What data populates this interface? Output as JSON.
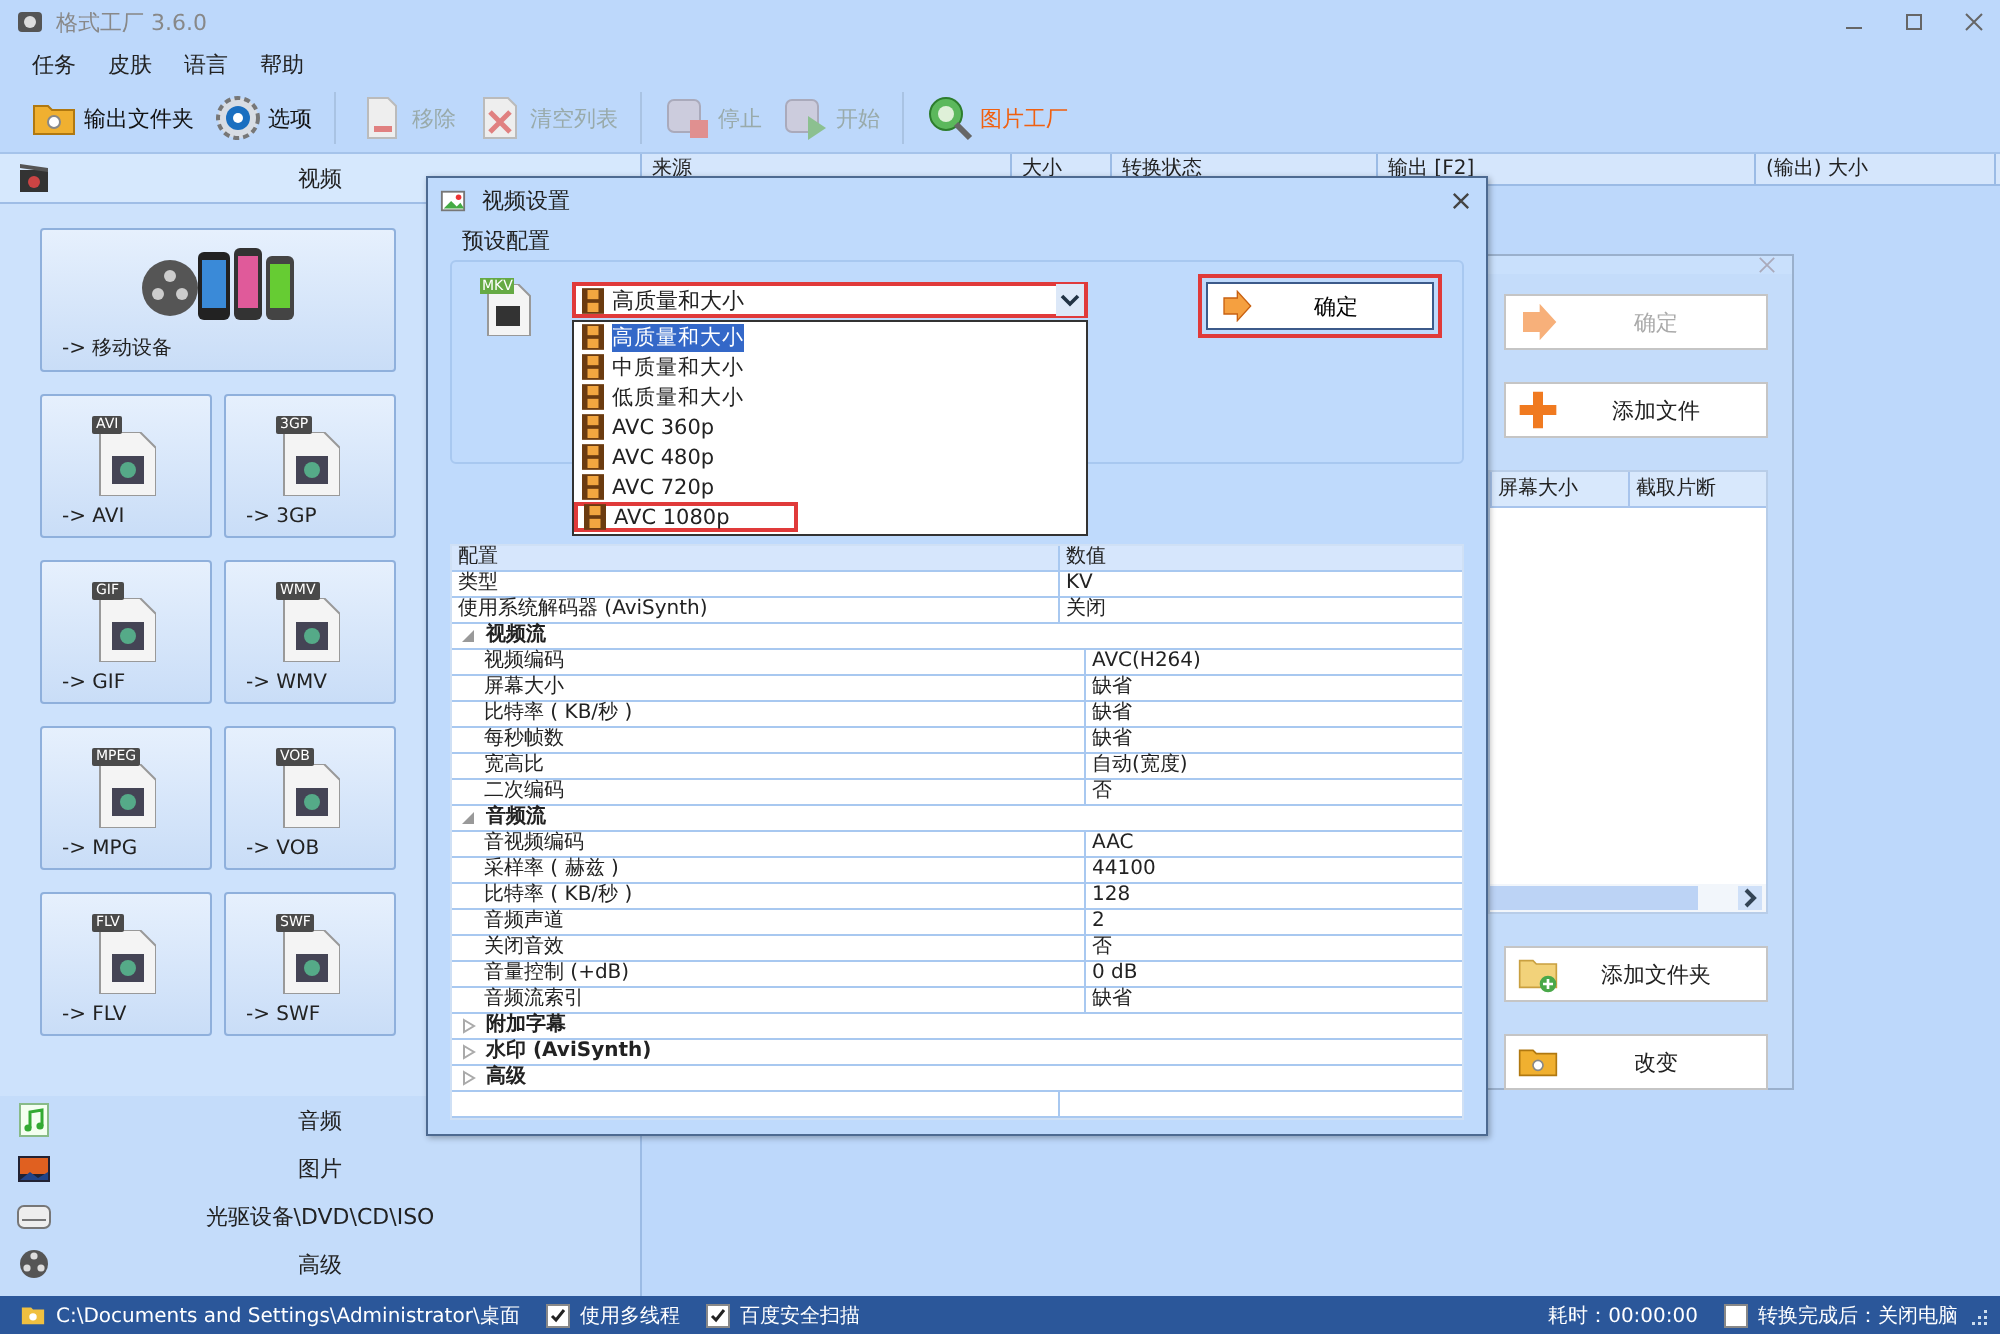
{
  "window": {
    "title": "格式工厂 3.6.0"
  },
  "menu": [
    {
      "label": "任务"
    },
    {
      "label": "皮肤"
    },
    {
      "label": "语言"
    },
    {
      "label": "帮助"
    }
  ],
  "toolbar": [
    {
      "label": "输出文件夹",
      "kind": "folder",
      "disabled": false,
      "accent": false
    },
    {
      "label": "选项",
      "kind": "gear",
      "disabled": false,
      "accent": false
    },
    {
      "label": "移除",
      "kind": "remove",
      "disabled": true,
      "accent": false
    },
    {
      "label": "清空列表",
      "kind": "clear",
      "disabled": true,
      "accent": false
    },
    {
      "label": "停止",
      "kind": "stop",
      "disabled": true,
      "accent": false
    },
    {
      "label": "开始",
      "kind": "start",
      "disabled": true,
      "accent": false
    },
    {
      "label": "图片工厂",
      "kind": "picture",
      "disabled": false,
      "accent": true
    }
  ],
  "sidebar": {
    "categories": [
      {
        "label": "视频",
        "kind": "video",
        "expanded": true,
        "tiles": [
          {
            "label": "-> 移动设备",
            "kind": "devices"
          },
          {
            "label": "-> AVI",
            "kind": "format",
            "badge": "AVI"
          },
          {
            "label": "-> 3GP",
            "kind": "format",
            "badge": "3GP"
          },
          {
            "label": "-> GIF",
            "kind": "format",
            "badge": "GIF"
          },
          {
            "label": "-> WMV",
            "kind": "format",
            "badge": "WMV"
          },
          {
            "label": "-> MPG",
            "kind": "format",
            "badge": "MPEG"
          },
          {
            "label": "-> VOB",
            "kind": "format",
            "badge": "VOB"
          },
          {
            "label": "-> FLV",
            "kind": "format",
            "badge": "FLV"
          },
          {
            "label": "-> SWF",
            "kind": "format",
            "badge": "SWF"
          }
        ]
      },
      {
        "label": "音频",
        "kind": "audio",
        "expanded": false
      },
      {
        "label": "图片",
        "kind": "picture",
        "expanded": false
      },
      {
        "label": "光驱设备\\DVD\\CD\\ISO",
        "kind": "disc",
        "expanded": false
      },
      {
        "label": "高级",
        "kind": "advanced",
        "expanded": false
      }
    ]
  },
  "file_table": {
    "columns": [
      "来源",
      "大小",
      "转换状态",
      "输出 [F2]",
      "(输出) 大小"
    ]
  },
  "background_dialog": {
    "buttons": [
      {
        "label": "确定",
        "kind": "ok",
        "disabled": true
      },
      {
        "label": "添加文件",
        "kind": "add",
        "disabled": false
      }
    ],
    "columns": [
      "屏幕大小",
      "截取片断"
    ],
    "bottom_buttons": [
      {
        "label": "添加文件夹",
        "kind": "add-folder",
        "disabled": false
      },
      {
        "label": "改变",
        "kind": "change",
        "disabled": false
      }
    ]
  },
  "dialog": {
    "title": "视频设置",
    "preset_group": "预设配置",
    "format_badge": "MKV",
    "combo": {
      "value": "高质量和大小",
      "highlighted": true,
      "expanded": true,
      "options": [
        {
          "label": "高质量和大小",
          "selected": true,
          "highlighted": false
        },
        {
          "label": "中质量和大小",
          "selected": false,
          "highlighted": false
        },
        {
          "label": "低质量和大小",
          "selected": false,
          "highlighted": false
        },
        {
          "label": "AVC 360p",
          "selected": false,
          "highlighted": false
        },
        {
          "label": "AVC 480p",
          "selected": false,
          "highlighted": false
        },
        {
          "label": "AVC 720p",
          "selected": false,
          "highlighted": false
        },
        {
          "label": "AVC 1080p",
          "selected": false,
          "highlighted": true
        }
      ]
    },
    "ok_button": {
      "label": "确定",
      "highlighted": true
    },
    "grid": {
      "columns": [
        "配置",
        "数值"
      ],
      "rows": [
        {
          "label": "类型",
          "value": "KV"
        },
        {
          "label": "使用系统解码器 (AviSynth)",
          "value": "关闭"
        }
      ],
      "groups": [
        {
          "label": "视频流",
          "expanded": true,
          "children": [
            {
              "label": "视频编码",
              "value": "AVC(H264)"
            },
            {
              "label": "屏幕大小",
              "value": "缺省"
            },
            {
              "label": "比特率 ( KB/秒 )",
              "value": "缺省"
            },
            {
              "label": "每秒帧数",
              "value": "缺省"
            },
            {
              "label": "宽高比",
              "value": "自动(宽度)"
            },
            {
              "label": "二次编码",
              "value": "否"
            }
          ]
        },
        {
          "label": "音频流",
          "expanded": true,
          "children": [
            {
              "label": "音视频编码",
              "value": "AAC"
            },
            {
              "label": "采样率 ( 赫兹 )",
              "value": "44100"
            },
            {
              "label": "比特率 ( KB/秒 )",
              "value": "128"
            },
            {
              "label": "音频声道",
              "value": "2"
            },
            {
              "label": "关闭音效",
              "value": "否"
            },
            {
              "label": "音量控制 (+dB)",
              "value": "0 dB"
            },
            {
              "label": "音频流索引",
              "value": "缺省"
            }
          ]
        },
        {
          "label": "附加字幕",
          "expanded": false
        },
        {
          "label": "水印 (AviSynth)",
          "expanded": false
        },
        {
          "label": "高级",
          "expanded": false
        }
      ]
    }
  },
  "status_bar": {
    "path": "C:\\Documents and Settings\\Administrator\\桌面",
    "options": [
      {
        "label": "使用多线程",
        "checked": true
      },
      {
        "label": "百度安全扫描",
        "checked": true
      }
    ],
    "elapsed": "耗时：00:00:00",
    "shutdown": {
      "label": "转换完成后：关闭电脑",
      "checked": false
    }
  }
}
